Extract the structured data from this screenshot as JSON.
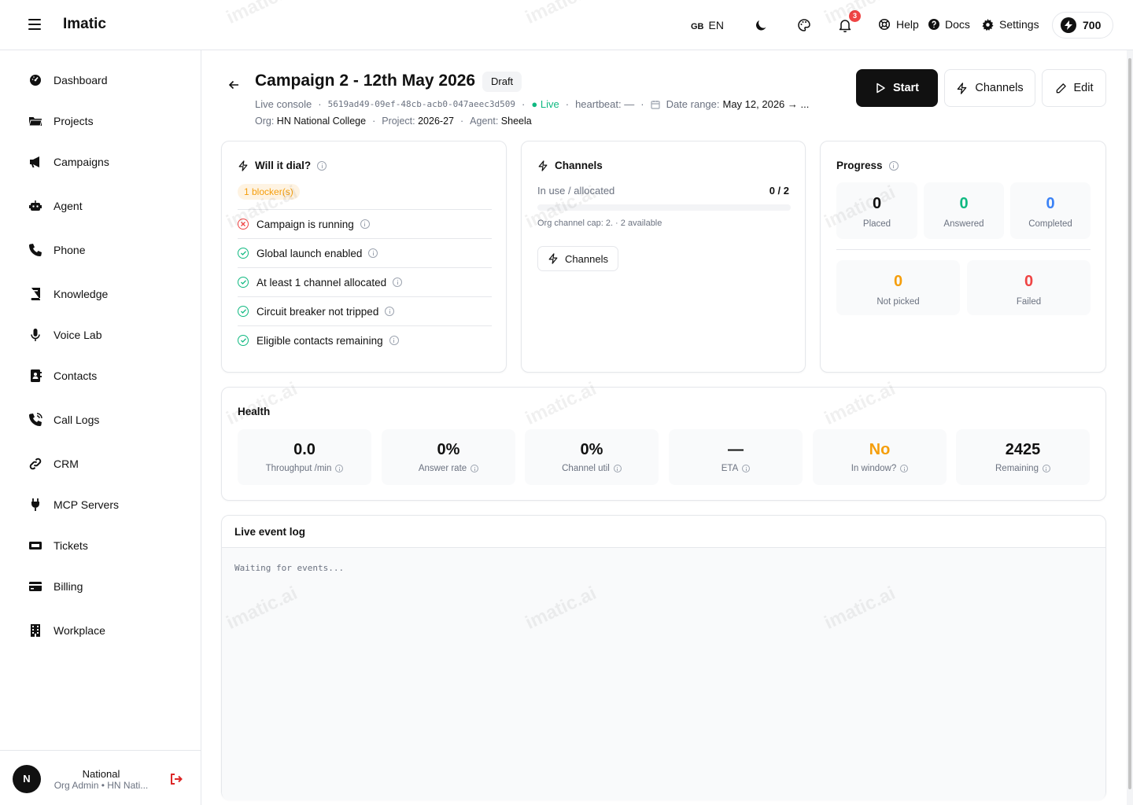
{
  "app": {
    "name": "Imatic"
  },
  "topbar": {
    "lang_flag": "GB",
    "lang_code": "EN",
    "notif_count": "3",
    "help": "Help",
    "docs": "Docs",
    "settings": "Settings",
    "credits": "700"
  },
  "sidebar": {
    "items": [
      {
        "label": "Dashboard",
        "icon": "dashboard-icon"
      },
      {
        "label": "Projects",
        "icon": "folder-icon"
      },
      {
        "label": "Campaigns",
        "icon": "megaphone-icon"
      },
      {
        "label": "Agent",
        "icon": "robot-icon"
      },
      {
        "label": "Phone",
        "icon": "phone-icon"
      },
      {
        "label": "Knowledge",
        "icon": "book-icon"
      },
      {
        "label": "Voice Lab",
        "icon": "microphone-icon"
      },
      {
        "label": "Contacts",
        "icon": "contact-book-icon"
      },
      {
        "label": "Call Logs",
        "icon": "phone-log-icon"
      },
      {
        "label": "CRM",
        "icon": "link-icon"
      },
      {
        "label": "MCP Servers",
        "icon": "plug-icon"
      },
      {
        "label": "Tickets",
        "icon": "ticket-icon"
      },
      {
        "label": "Billing",
        "icon": "credit-card-icon"
      },
      {
        "label": "Workplace",
        "icon": "building-icon"
      }
    ],
    "user": {
      "initial": "N",
      "name": "National",
      "role": "Org Admin • HN Nati..."
    }
  },
  "header": {
    "title": "Campaign 2 - 12th May 2026",
    "status": "Draft",
    "console": "Live console",
    "id": "5619ad49-09ef-48cb-acb0-047aeec3d509",
    "live": "Live",
    "heartbeat": "heartbeat: —",
    "date_label": "Date range:",
    "date_value": "May 12, 2026 → ...",
    "org_label": "Org:",
    "org": "HN National College",
    "project_label": "Project:",
    "project": "2026-27",
    "agent_label": "Agent:",
    "agent": "Sheela",
    "start": "Start",
    "channels": "Channels",
    "edit": "Edit"
  },
  "dial": {
    "title": "Will it dial?",
    "blockers": "1 blocker(s)",
    "checks": [
      {
        "label": "Campaign is running",
        "ok": false
      },
      {
        "label": "Global launch enabled",
        "ok": true
      },
      {
        "label": "At least 1 channel allocated",
        "ok": true
      },
      {
        "label": "Circuit breaker not tripped",
        "ok": true
      },
      {
        "label": "Eligible contacts remaining",
        "ok": true
      }
    ]
  },
  "channels": {
    "title": "Channels",
    "usage_label": "In use / allocated",
    "usage_value": "0 / 2",
    "usage_fraction": 0,
    "cap_text": "Org channel cap: 2. · 2 available",
    "button": "Channels"
  },
  "progress": {
    "title": "Progress",
    "placed": {
      "value": "0",
      "label": "Placed"
    },
    "answered": {
      "value": "0",
      "label": "Answered"
    },
    "completed": {
      "value": "0",
      "label": "Completed"
    },
    "not_picked": {
      "value": "0",
      "label": "Not picked"
    },
    "failed": {
      "value": "0",
      "label": "Failed"
    },
    "colors": {
      "answered": "#10b981",
      "completed": "#3b82f6",
      "not_picked": "#f59e0b",
      "failed": "#ef4444"
    }
  },
  "health": {
    "title": "Health",
    "stats": [
      {
        "value": "0.0",
        "label": "Throughput /min"
      },
      {
        "value": "0%",
        "label": "Answer rate"
      },
      {
        "value": "0%",
        "label": "Channel util"
      },
      {
        "value": "—",
        "label": "ETA"
      },
      {
        "value": "No",
        "label": "In window?"
      },
      {
        "value": "2425",
        "label": "Remaining"
      }
    ]
  },
  "log": {
    "title": "Live event log",
    "empty": "Waiting for events..."
  },
  "watermark": "imatic.ai"
}
